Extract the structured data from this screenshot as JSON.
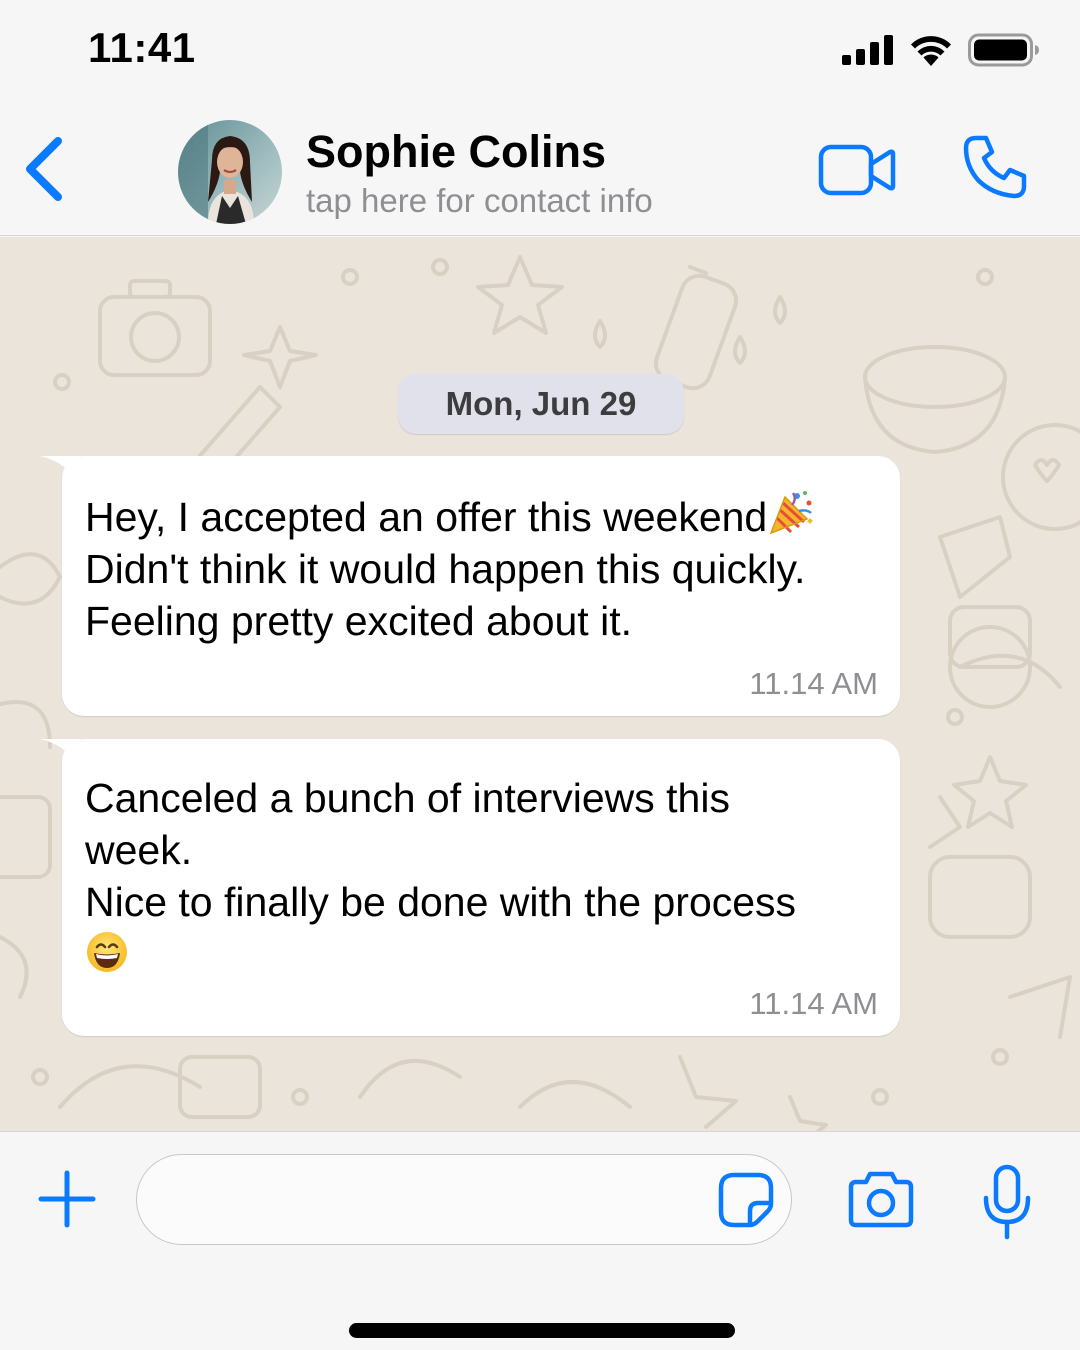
{
  "status_bar": {
    "time": "11:41",
    "icons": [
      "cellular-signal-icon",
      "wifi-icon",
      "battery-icon"
    ]
  },
  "header": {
    "back_icon": "chevron-left-icon",
    "contact_name": "Sophie Colins",
    "contact_subtitle": "tap here for contact info",
    "actions": [
      "video-call-icon",
      "phone-icon"
    ]
  },
  "chat": {
    "date_separator": "Mon, Jun 29",
    "messages": [
      {
        "lines": [
          "Hey, I accepted an offer this weekend",
          "Didn't think it would happen this quickly.",
          "Feeling pretty excited about it."
        ],
        "emoji": "party-popper-emoji",
        "time": "11.14 AM"
      },
      {
        "lines": [
          "Canceled a bunch of interviews this",
          "week.",
          "Nice to finally be done with the process"
        ],
        "emoji": "grinning-face-emoji",
        "time": "11.14 AM"
      }
    ]
  },
  "input_bar": {
    "value": "",
    "placeholder": "",
    "icons": [
      "plus-icon",
      "sticker-icon",
      "camera-icon",
      "microphone-icon"
    ]
  },
  "colors": {
    "accent": "#0a7aff",
    "header_bg": "#f6f6f6",
    "chat_bg": "#ebe4da",
    "bubble_bg": "#ffffff",
    "date_pill_bg": "#e1e1ec",
    "secondary_text": "#8e8e93"
  }
}
